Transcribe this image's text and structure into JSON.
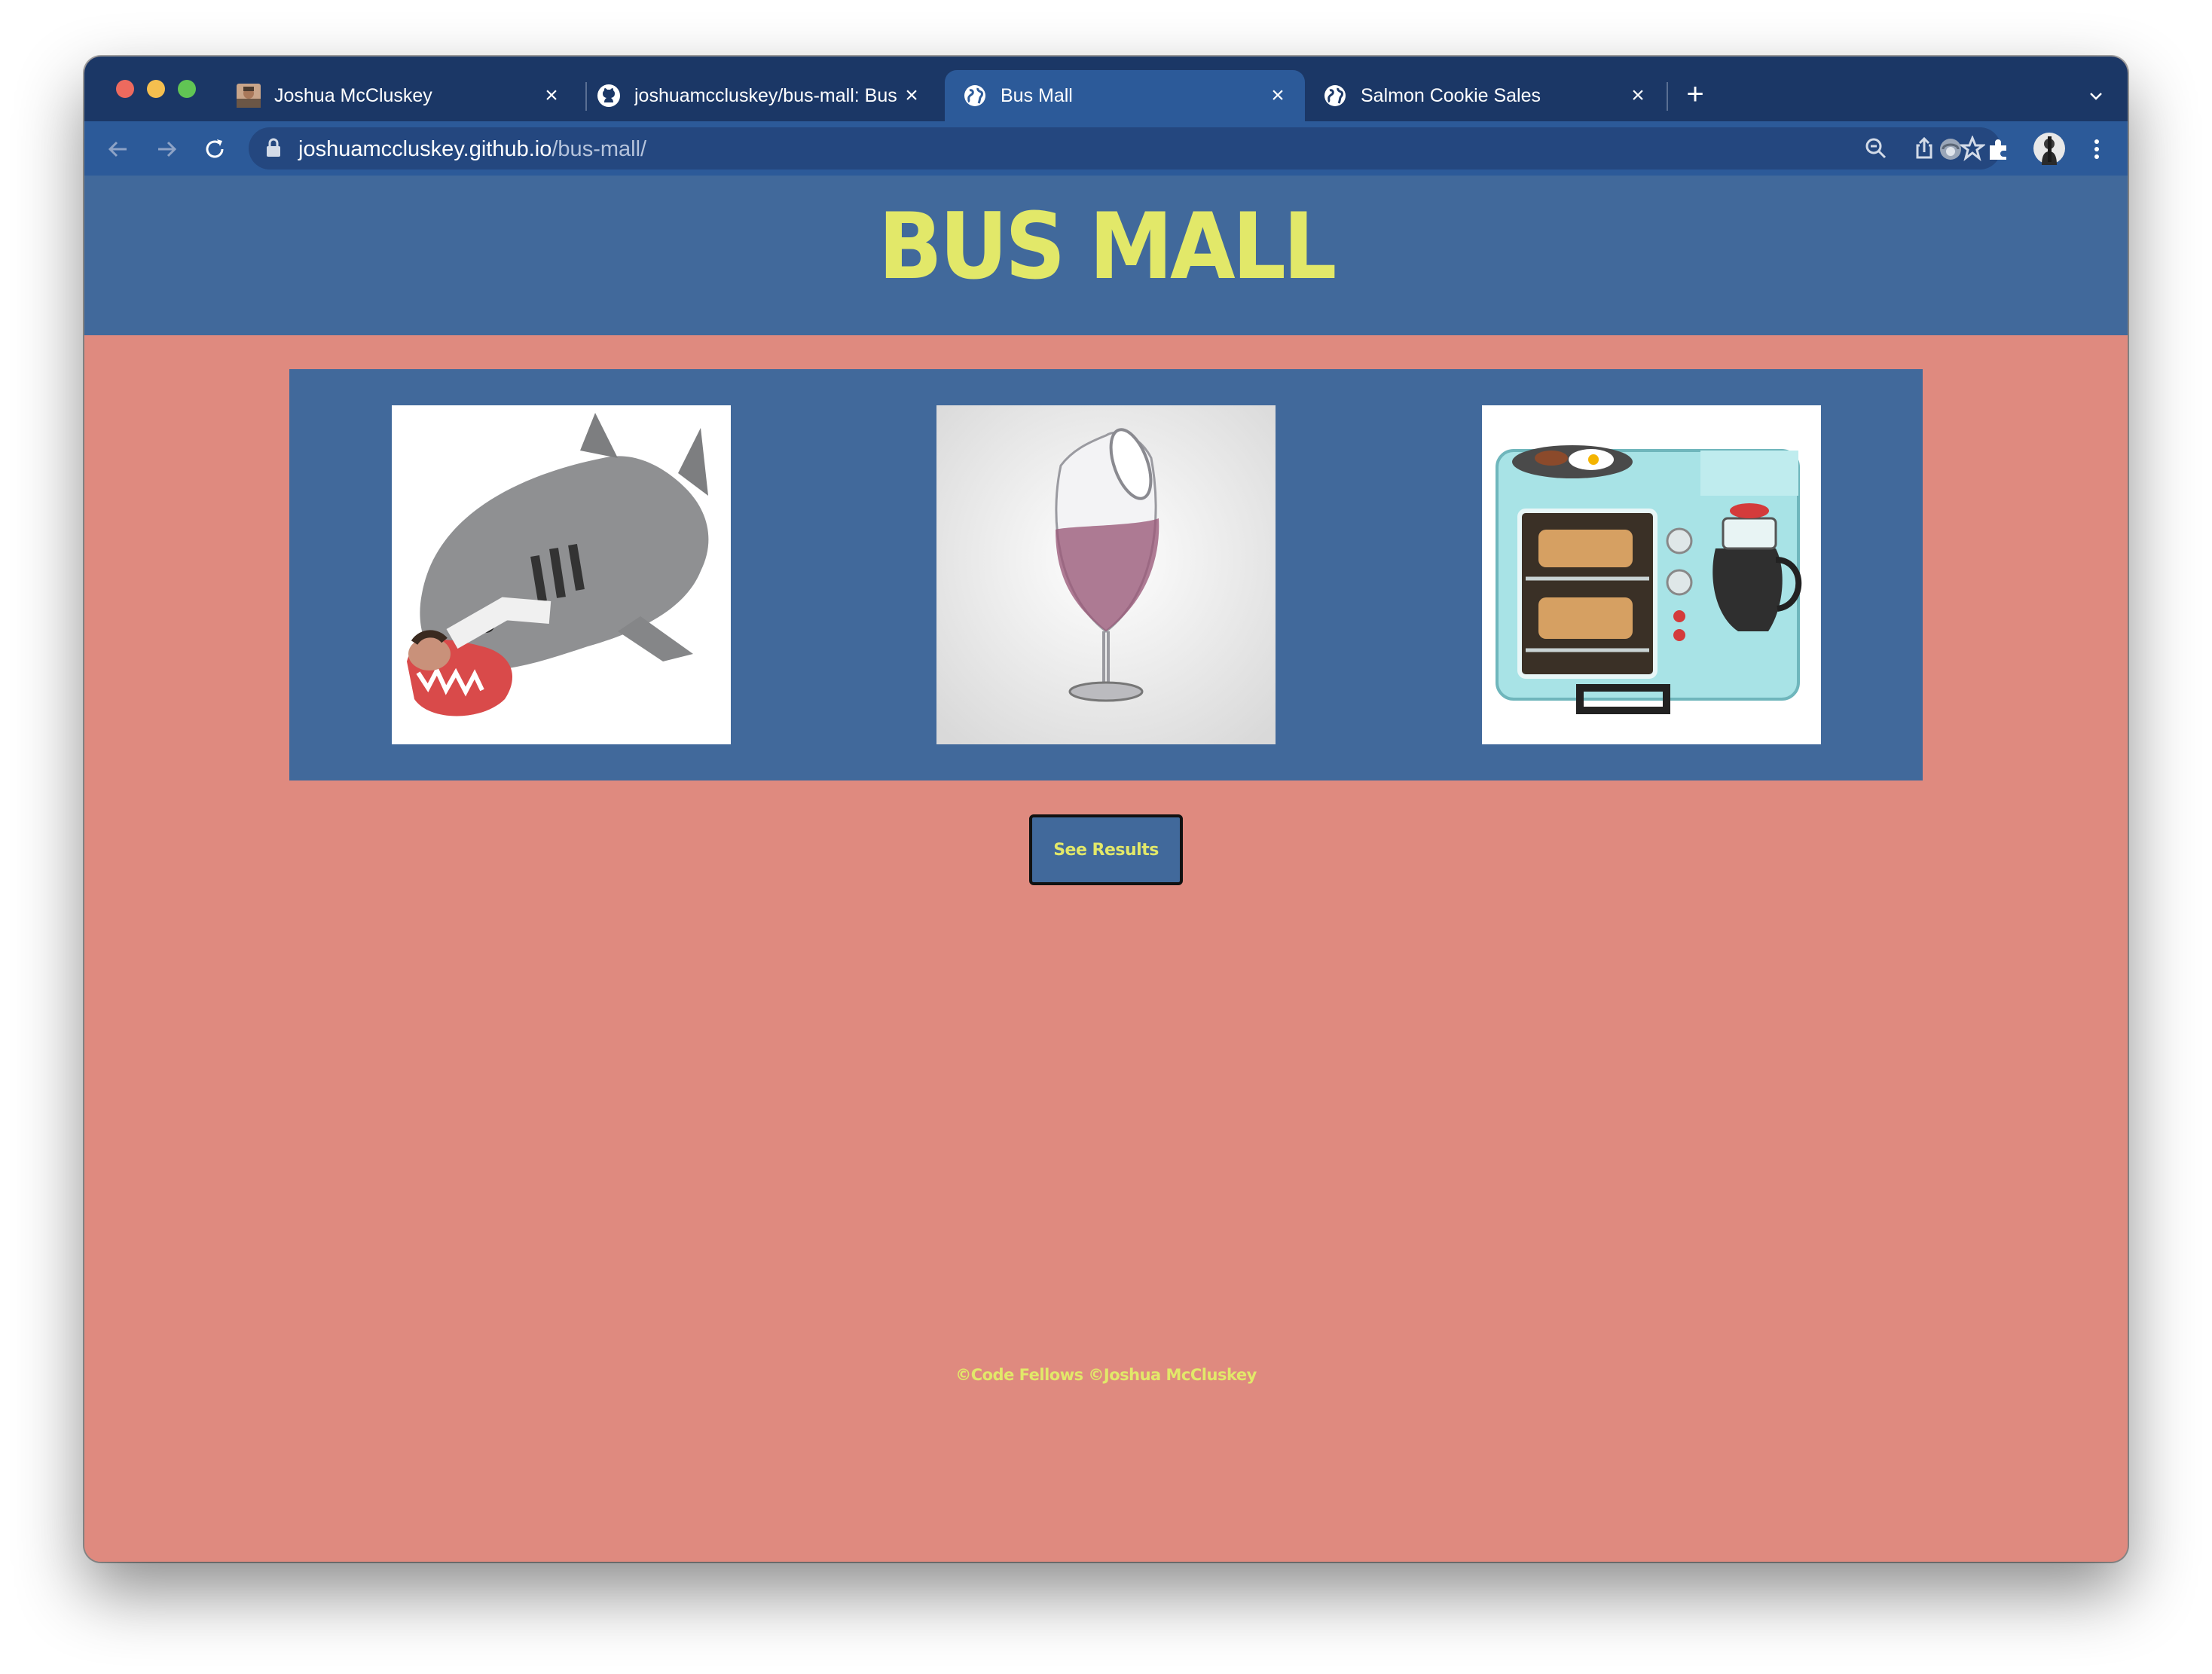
{
  "browser": {
    "tabs": [
      {
        "label": "Joshua McCluskey",
        "icon": "avatar-photo-icon"
      },
      {
        "label": "joshuamccluskey/bus-mall: Bus",
        "icon": "github-icon"
      },
      {
        "label": "Bus Mall",
        "icon": "globe-icon"
      },
      {
        "label": "Salmon Cookie Sales",
        "icon": "globe-icon"
      }
    ],
    "url": {
      "host": "joshuamccluskey.github.io",
      "path": "/bus-mall/"
    }
  },
  "page": {
    "title": "BUS MALL",
    "products": [
      {
        "name": "shark",
        "icon": "shark-sleeping-bag-image"
      },
      {
        "name": "wine-glass",
        "icon": "wine-glass-image"
      },
      {
        "name": "breakfast",
        "icon": "breakfast-maker-image"
      }
    ],
    "results_button": "See Results",
    "footer": "©Code Fellows ©Joshua McCluskey"
  },
  "colors": {
    "header_bg": "#41699b",
    "page_bg": "#df8a7f",
    "accent_text": "#e2e869",
    "tab_strip": "#1b3766",
    "toolbar": "#2c5a99"
  }
}
